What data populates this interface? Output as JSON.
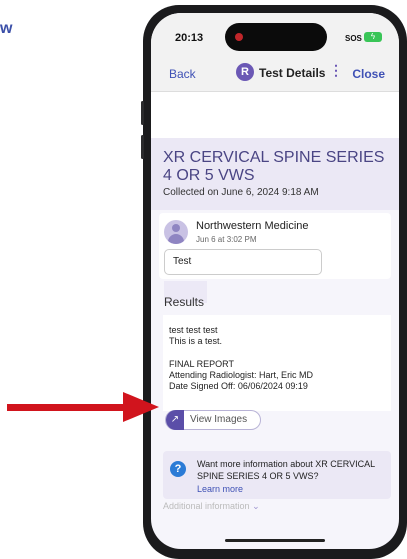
{
  "corner_text": "w",
  "status_bar": {
    "time": "20:13",
    "sos": "SOS"
  },
  "nav": {
    "back": "Back",
    "avatar_initial": "R",
    "title": "Test Details",
    "menu_glyph": "⋮",
    "close": "Close"
  },
  "test": {
    "title": "XR CERVICAL SPINE SERIES 4 OR 5 VWS",
    "collected": "Collected on June 6, 2024 9:18 AM"
  },
  "message": {
    "sender": "Northwestern Medicine",
    "date": "Jun 6 at 3:02 PM",
    "text": "Test"
  },
  "results": {
    "heading": "Results",
    "lines": [
      "test test test",
      "This is a test.",
      "",
      "FINAL REPORT",
      "Attending Radiologist: Hart, Eric MD",
      "Date Signed Off: 06/06/2024 09:19"
    ],
    "view_images": "View Images"
  },
  "info": {
    "line1": "Want more information about XR CERVICAL",
    "line2": "SPINE SERIES 4 OR 5 VWS?",
    "learn_more": "Learn more"
  },
  "additional": "Additional information",
  "colors": {
    "accent": "#5b4ea8",
    "link": "#3f51b5",
    "arrow": "#d1141d",
    "header_tint": "#ebe8f5"
  }
}
